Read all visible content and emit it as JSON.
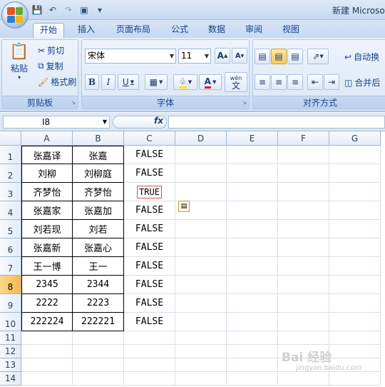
{
  "app": {
    "title": "新建 Microso"
  },
  "tabs": [
    {
      "label": "开始",
      "active": true
    },
    {
      "label": "插入"
    },
    {
      "label": "页面布局"
    },
    {
      "label": "公式"
    },
    {
      "label": "数据"
    },
    {
      "label": "审阅"
    },
    {
      "label": "视图"
    }
  ],
  "clipboard": {
    "paste": "粘贴",
    "cut": "剪切",
    "copy": "复制",
    "format_painter": "格式刷",
    "group_label": "剪贴板"
  },
  "font": {
    "name": "宋体",
    "size": "11",
    "bold": "B",
    "italic": "I",
    "underline": "U",
    "grow": "A",
    "shrink": "A",
    "group_label": "字体",
    "wen": "wén",
    "wen_char": "文"
  },
  "alignment": {
    "wrap_text": "自动换",
    "merge": "合并后",
    "group_label": "对齐方式"
  },
  "formula_bar": {
    "name_box": "I8",
    "fx": "fx",
    "value": ""
  },
  "columns": [
    "A",
    "B",
    "C",
    "D",
    "E",
    "F",
    "G"
  ],
  "rows": [
    "1",
    "2",
    "3",
    "4",
    "5",
    "6",
    "7",
    "8",
    "9",
    "10",
    "11",
    "12",
    "13",
    "14"
  ],
  "selected_row": "8",
  "table": [
    [
      "张嘉译",
      "张嘉",
      "FALSE"
    ],
    [
      "刘柳",
      "刘柳庭",
      "FALSE"
    ],
    [
      "齐梦怡",
      "齐梦怡",
      "TRUE"
    ],
    [
      "张嘉家",
      "张嘉加",
      "FALSE"
    ],
    [
      "刘若现",
      "刘若",
      "FALSE"
    ],
    [
      "张嘉新",
      "张嘉心",
      "FALSE"
    ],
    [
      "王一博",
      "王一",
      "FALSE"
    ],
    [
      "2345",
      "2344",
      "FALSE"
    ],
    [
      "2222",
      "2223",
      "FALSE"
    ],
    [
      "222224",
      "222221",
      "FALSE"
    ]
  ],
  "watermark": {
    "main": "Bai 经验",
    "sub": "jingyan.baidu.com"
  },
  "colors": {
    "accent": "#15428b",
    "selected_row": "#f7b850",
    "true_border": "#e05050"
  }
}
